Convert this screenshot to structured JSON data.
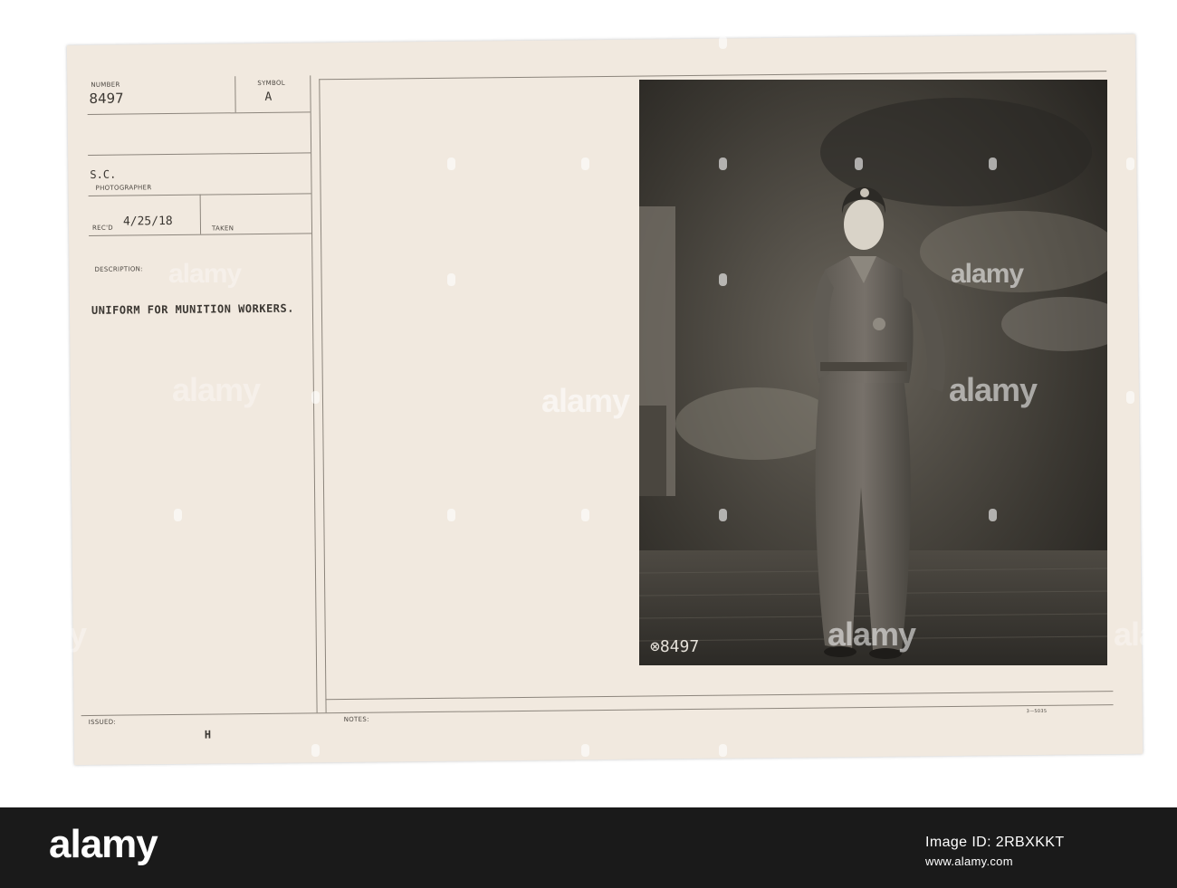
{
  "card": {
    "number_label": "NUMBER",
    "number_value": "8497",
    "symbol_label": "SYMBOL",
    "symbol_value": "A",
    "photographer_value": "S.C.",
    "photographer_label": "PHOTOGRAPHER",
    "recd_label": "REC'D",
    "recd_value": "4/25/18",
    "taken_label": "TAKEN",
    "description_label": "DESCRIPTION:",
    "description_text": "UNIFORM FOR MUNITION WORKERS.",
    "issued_label": "ISSUED:",
    "issued_value": "H",
    "notes_label": "NOTES:",
    "form_code": "3—5035"
  },
  "photo": {
    "negative_number": "⊗8497"
  },
  "watermark": {
    "text": "alamy"
  },
  "footer": {
    "logo": "alamy",
    "image_id": "Image ID: 2RBXKKT",
    "url": "www.alamy.com"
  }
}
